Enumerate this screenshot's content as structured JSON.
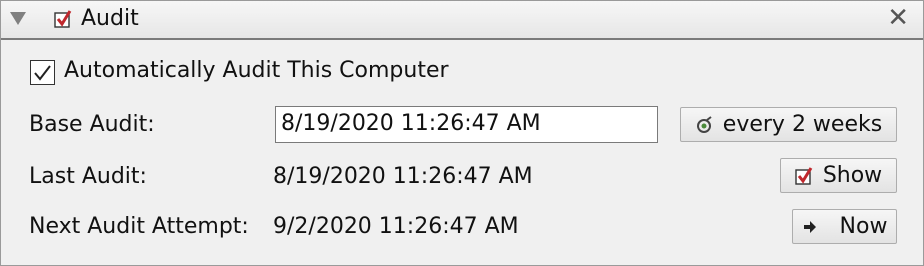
{
  "panel": {
    "title": "Audit",
    "close_glyph": "✕",
    "icons": {
      "collapse": "collapse-triangle-icon",
      "title": "audit-checkbox-icon",
      "close": "close-icon"
    }
  },
  "auto_audit": {
    "label": "Automatically Audit This Computer",
    "checked": true
  },
  "base_audit": {
    "label": "Base Audit:",
    "value": "8/19/2020 11:26:47 AM",
    "schedule_button": "every 2 weeks",
    "schedule_icon": "schedule-icon"
  },
  "last_audit": {
    "label": "Last Audit:",
    "value": "8/19/2020 11:26:47 AM",
    "show_button": "Show",
    "show_icon": "audit-checkbox-icon"
  },
  "next_audit": {
    "label": "Next Audit Attempt:",
    "value": "9/2/2020 11:26:47 AM",
    "now_button": "Now",
    "now_icon": "arrow-right-icon"
  },
  "colors": {
    "check_red": "#c0282d",
    "accent_green": "#4a8a3a"
  }
}
